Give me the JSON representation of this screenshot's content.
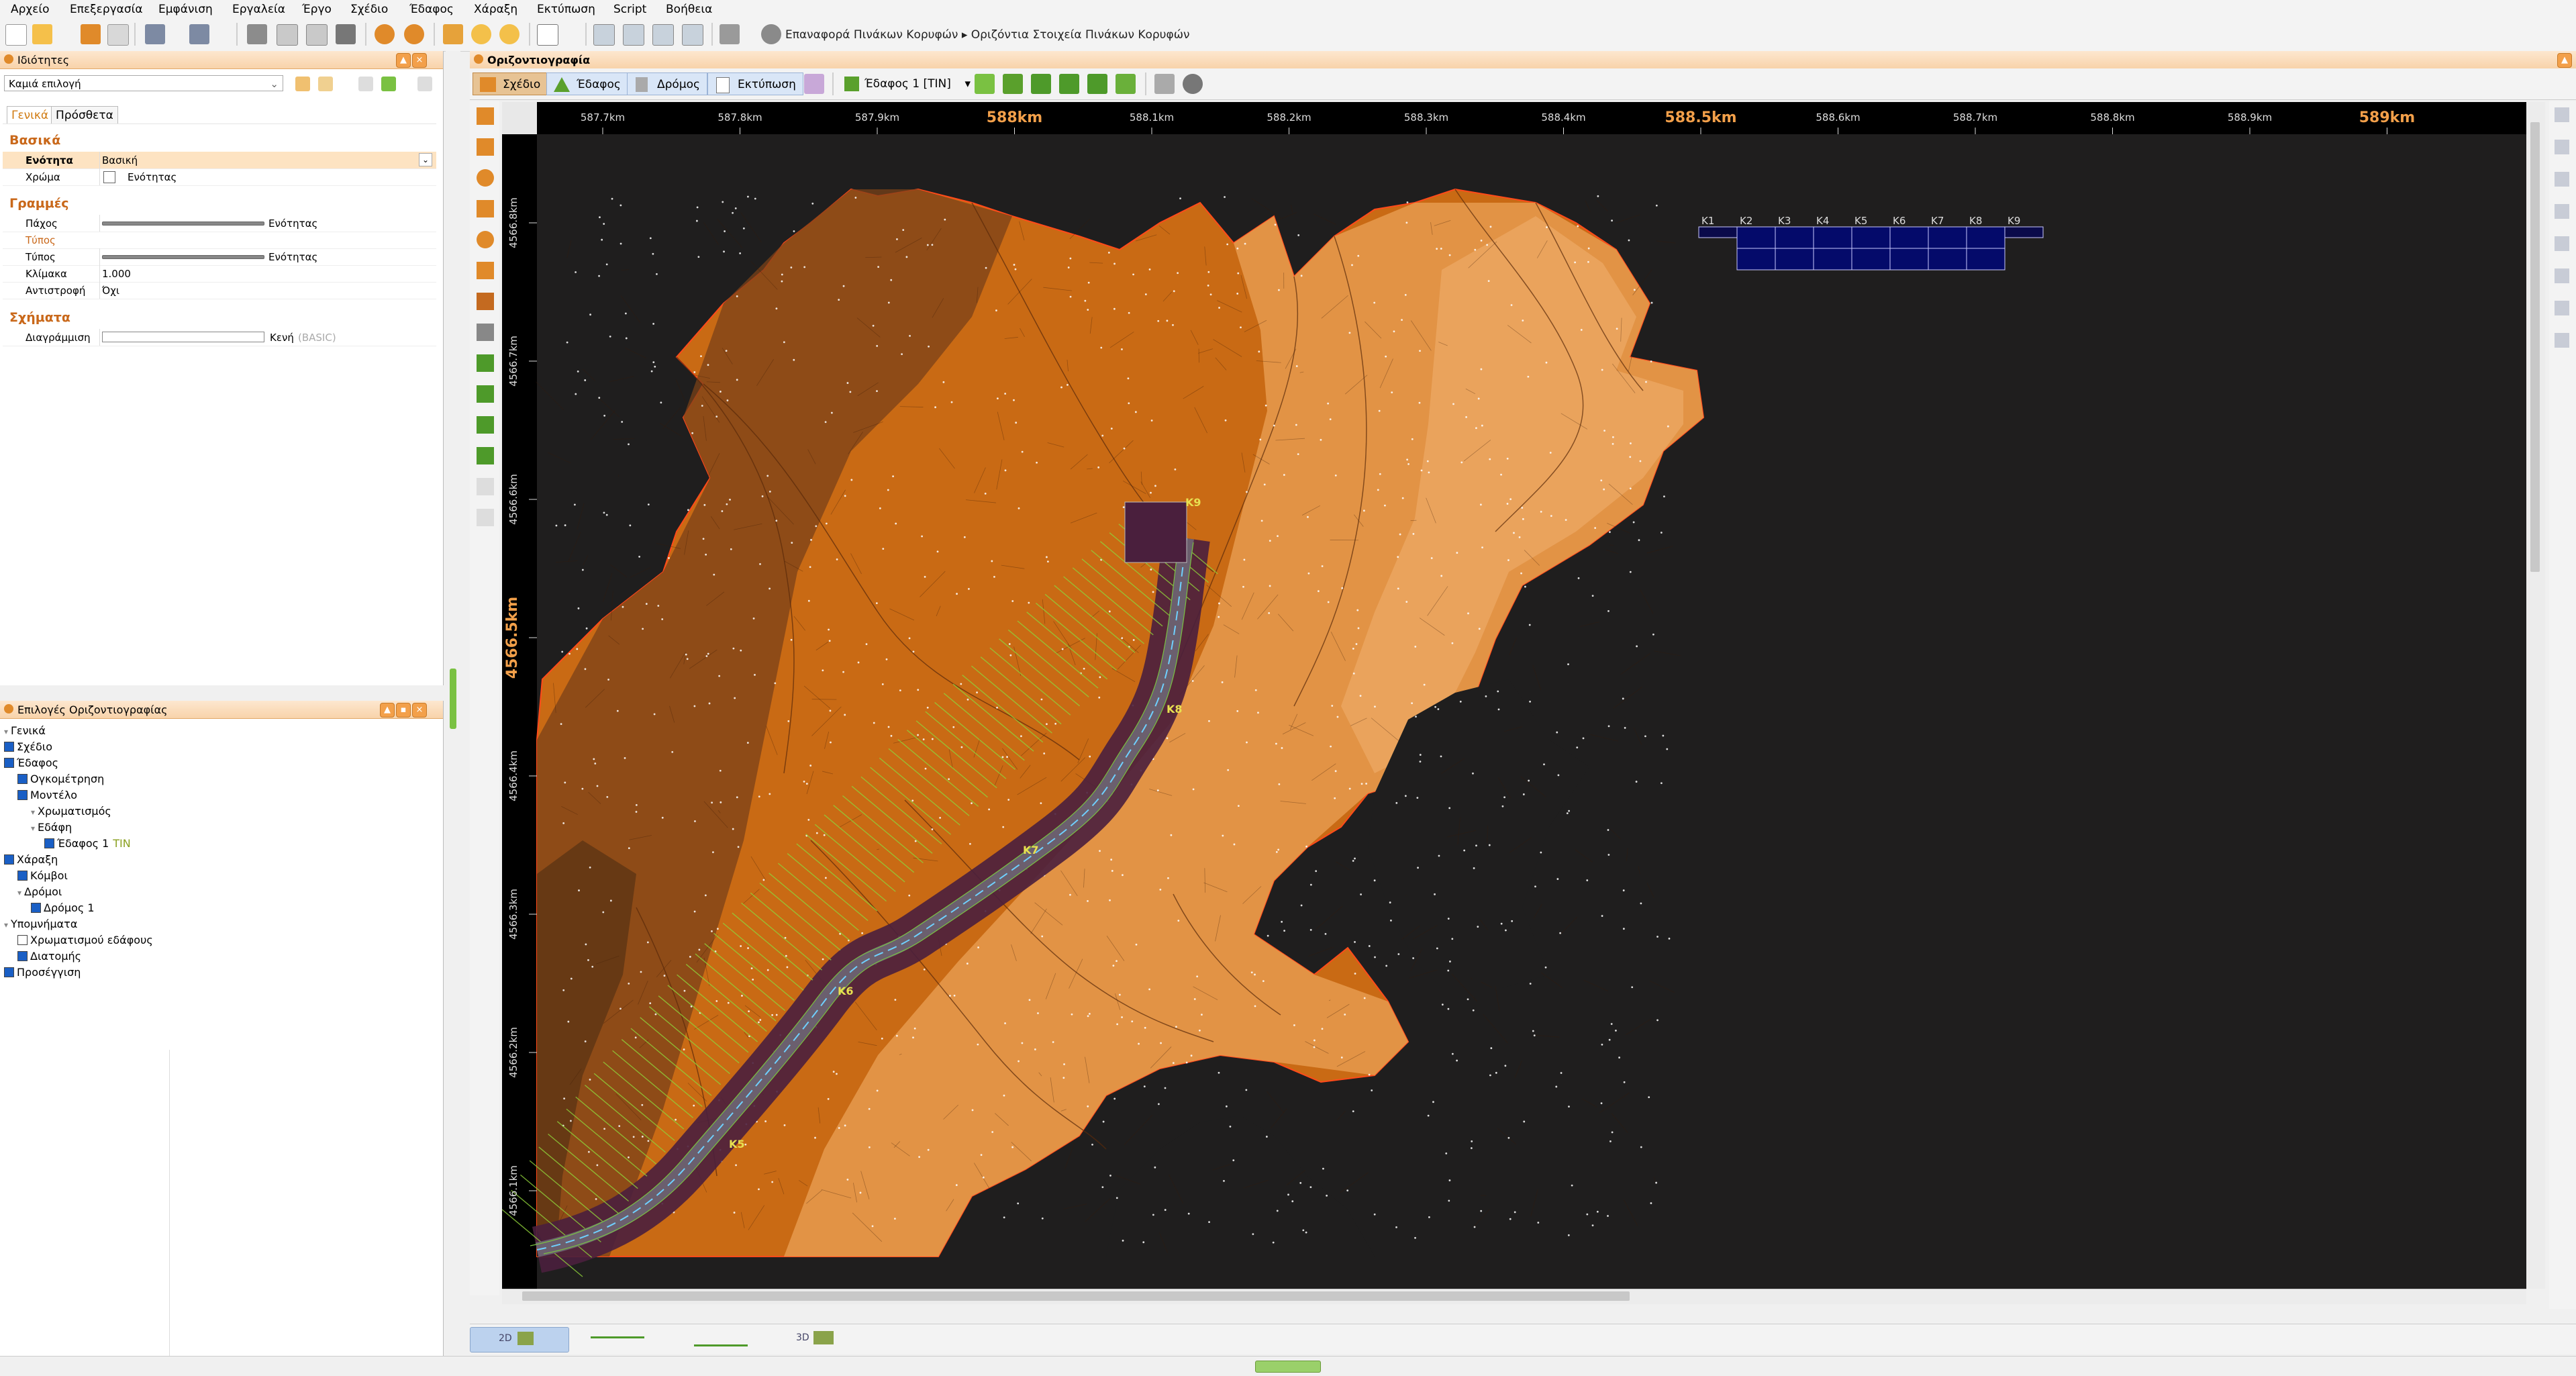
{
  "menu": [
    "Αρχείο",
    "Επεξεργασία",
    "Εμφάνιση",
    "Εργαλεία",
    "Έργο",
    "Σχέδιο",
    "Έδαφος",
    "Χάραξη",
    "Εκτύπωση",
    "Script",
    "Βοήθεια"
  ],
  "breadcrumb": {
    "first": "Επαναφορά Πινάκων Κορυφών",
    "sep": "▸",
    "second": "Οριζόντια Στοιχεία Πινάκων Κορυφών"
  },
  "properties_panel": {
    "title": "Ιδιότητες",
    "selection": "Καμιά επιλογή",
    "tabs": [
      "Γενικά",
      "Πρόσθετα"
    ],
    "sections": {
      "basic": {
        "title": "Βασικά",
        "rows": [
          {
            "key": "Ενότητα",
            "value": "Βασική"
          },
          {
            "key": "Χρώμα",
            "value": "Ενότητας"
          }
        ]
      },
      "lines": {
        "title": "Γραμμές",
        "rows": [
          {
            "key": "Πάχος",
            "value": "Ενότητας"
          },
          {
            "key": "Τύπος",
            "value": ""
          },
          {
            "key": "Τύπος",
            "value": "Ενότητας"
          },
          {
            "key": "Κλίμακα",
            "value": "1.000"
          },
          {
            "key": "Αντιστροφή",
            "value": "Όχι"
          }
        ]
      },
      "shapes": {
        "title": "Σχήματα",
        "rows": [
          {
            "key": "Διαγράμμιση",
            "value": "Κενή",
            "extra": "(BASIC)"
          }
        ]
      }
    }
  },
  "options_panel": {
    "title": "Επιλογές Οριζοντιογραφίας",
    "tree": [
      {
        "label": "Γενικά",
        "level": 0,
        "check": "none"
      },
      {
        "label": "Σχέδιο",
        "level": 0,
        "check": "on"
      },
      {
        "label": "Έδαφος",
        "level": 0,
        "check": "on"
      },
      {
        "label": "Ογκομέτρηση",
        "level": 1,
        "check": "on"
      },
      {
        "label": "Μοντέλο",
        "level": 1,
        "check": "on"
      },
      {
        "label": "Χρωματισμός",
        "level": 2,
        "check": "none"
      },
      {
        "label": "Εδάφη",
        "level": 2,
        "check": "none"
      },
      {
        "label": "Έδαφος 1",
        "level": 3,
        "check": "on",
        "tag": "TIN"
      },
      {
        "label": "Χάραξη",
        "level": 0,
        "check": "on"
      },
      {
        "label": "Κόμβοι",
        "level": 1,
        "check": "on"
      },
      {
        "label": "Δρόμοι",
        "level": 1,
        "check": "none"
      },
      {
        "label": "Δρόμος 1",
        "level": 2,
        "check": "on"
      },
      {
        "label": "Υπομνήματα",
        "level": 0,
        "check": "none"
      },
      {
        "label": "Χρωματισμού εδάφους",
        "level": 1,
        "check": "off"
      },
      {
        "label": "Διατομής",
        "level": 1,
        "check": "on"
      },
      {
        "label": "Προσέγγιση",
        "level": 0,
        "check": "on"
      }
    ]
  },
  "view": {
    "title": "Οριζοντιογραφία",
    "tabs": [
      "Σχέδιο",
      "Έδαφος",
      "Δρόμος",
      "Εκτύπωση"
    ],
    "surface_select": "Έδαφος 1 [TIN]",
    "ruler_x": [
      "587.7km",
      "587.8km",
      "587.9km",
      "588km",
      "588.1km",
      "588.2km",
      "588.3km",
      "588.4km",
      "588.5km",
      "588.6km",
      "588.7km",
      "588.8km",
      "588.9km",
      "589km"
    ],
    "ruler_y": [
      "4566.8km",
      "4566.7km",
      "4566.6km",
      "4566.5km",
      "4566.4km",
      "4566.3km",
      "4566.2km",
      "4566.1km"
    ],
    "vertex_table": [
      "K1",
      "K2",
      "K3",
      "K4",
      "K5",
      "K6",
      "K7",
      "K8",
      "K9"
    ],
    "road_labels": [
      "K9",
      "K8",
      "K7",
      "K6",
      "K5"
    ]
  },
  "bottom_tabs": [
    "2D",
    "",
    "",
    "3D"
  ],
  "colors": {
    "accent": "#f3a04a",
    "terrain_dark": "#7a4218",
    "terrain_mid": "#c96a14",
    "terrain_light": "#e69a4e",
    "road": "#4a1f3d",
    "canvas": "#1f1e1e"
  }
}
